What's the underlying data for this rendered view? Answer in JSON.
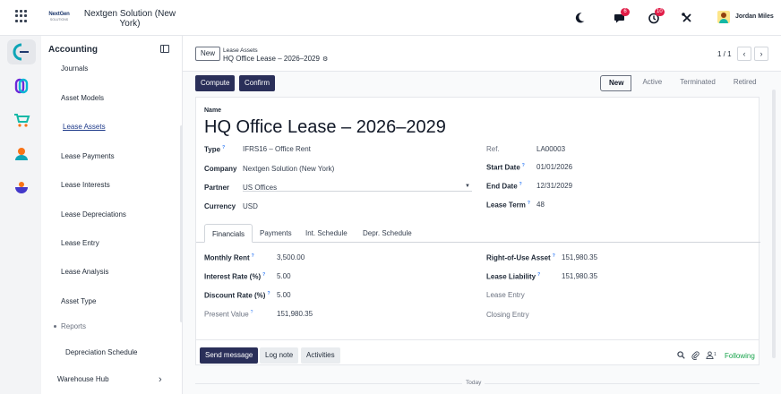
{
  "topbar": {
    "logo_line1": "NextGen",
    "logo_line2": "SOLUTIONS",
    "company": "Nextgen Solution (New York)",
    "messages_count": "6",
    "activities_count": "10",
    "user": "Jordan Miles"
  },
  "sidebar": {
    "title": "Accounting",
    "items": [
      "Journals",
      "Asset Models",
      "Lease Assets",
      "Lease Payments",
      "Lease Interests",
      "Lease Depreciations",
      "Lease Entry",
      "Lease Analysis",
      "Asset Type"
    ],
    "active": "Lease Assets",
    "reports_label": "Reports",
    "depr_schedule": "Depreciation Schedule",
    "warehouse": "Warehouse Hub"
  },
  "breadcrumb": {
    "new_label": "New",
    "parent": "Lease Assets",
    "current": "HQ Office Lease – 2026–2029",
    "pager": "1 / 1"
  },
  "actions": {
    "compute": "Compute",
    "confirm": "Confirm"
  },
  "status": {
    "stages": [
      "New",
      "Active",
      "Terminated",
      "Retired"
    ],
    "current": "New"
  },
  "form": {
    "name_label": "Name",
    "name": "HQ Office Lease – 2026–2029",
    "type_label": "Type",
    "type": "IFRS16 – Office Rent",
    "company_label": "Company",
    "company": "Nextgen Solution (New York)",
    "partner_label": "Partner",
    "partner": "US Offices",
    "currency_label": "Currency",
    "currency": "USD",
    "ref_label": "Ref.",
    "ref": "LA00003",
    "start_label": "Start Date",
    "start": "01/01/2026",
    "end_label": "End Date",
    "end": "12/31/2029",
    "term_label": "Lease Term",
    "term": "48"
  },
  "tabs": [
    "Financials",
    "Payments",
    "Int. Schedule",
    "Depr. Schedule"
  ],
  "financials": {
    "rent_label": "Monthly Rent",
    "rent": "3,500.00",
    "rate_label": "Interest Rate (%)",
    "rate": "5.00",
    "disc_label": "Discount Rate (%)",
    "disc": "5.00",
    "pv_label": "Present Value",
    "pv": "151,980.35",
    "rou_label": "Right-of-Use Asset",
    "rou": "151,980.35",
    "liab_label": "Lease Liability",
    "liab": "151,980.35",
    "entry_label": "Lease Entry",
    "closing_label": "Closing Entry"
  },
  "chatter": {
    "send": "Send message",
    "log": "Log note",
    "activities": "Activities",
    "followers": "1",
    "following": "Following",
    "today": "Today"
  },
  "colors": {
    "primary": "#2a2f59",
    "following": "#16a34a",
    "badge": "#e11d48"
  }
}
